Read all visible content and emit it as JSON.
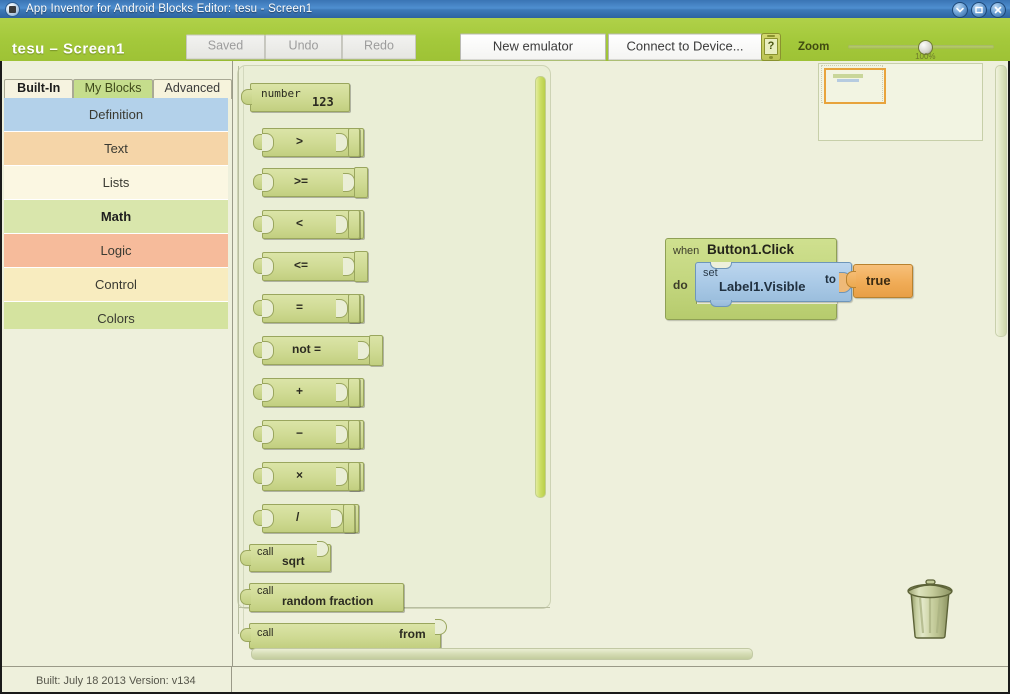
{
  "window": {
    "title": "App Inventor for Android Blocks Editor: tesu - Screen1",
    "app_icon": "app-icon",
    "minimize_icon": "minimize-icon",
    "maximize_icon": "maximize-icon",
    "close_icon": "close-icon"
  },
  "toolbar": {
    "project_title": "tesu – Screen1",
    "saved_label": "Saved",
    "undo_label": "Undo",
    "redo_label": "Redo",
    "new_emulator_label": "New emulator",
    "connect_label": "Connect to Device...",
    "help_icon_label": "?",
    "zoom_label": "Zoom",
    "zoom_value": "100%",
    "accent_green": "#a4c93b"
  },
  "left_panel": {
    "tabs": [
      {
        "label": "Built-In",
        "selected": true
      },
      {
        "label": "My Blocks",
        "selected": false
      },
      {
        "label": "Advanced",
        "selected": false
      }
    ],
    "categories": [
      {
        "label": "Definition",
        "color": "#b3d1ea",
        "selected": false
      },
      {
        "label": "Text",
        "color": "#f5d5a8",
        "selected": false
      },
      {
        "label": "Lists",
        "color": "#fbf7e2",
        "selected": false
      },
      {
        "label": "Math",
        "color": "#d9e6ac",
        "selected": true
      },
      {
        "label": "Logic",
        "color": "#f6bb9b",
        "selected": false
      },
      {
        "label": "Control",
        "color": "#f8ecbf",
        "selected": false
      },
      {
        "label": "Colors",
        "color": "#d4e39f",
        "selected": false
      }
    ]
  },
  "status_bar": {
    "build_info": "Built: July 18 2013 Version: v134"
  },
  "palette": {
    "category": "Math",
    "blocks": [
      {
        "kind": "number",
        "label": "number",
        "value": "123"
      },
      {
        "kind": "operator",
        "label": ">"
      },
      {
        "kind": "operator",
        "label": ">="
      },
      {
        "kind": "operator",
        "label": "<"
      },
      {
        "kind": "operator",
        "label": "<="
      },
      {
        "kind": "operator",
        "label": "="
      },
      {
        "kind": "operator",
        "label": "not ="
      },
      {
        "kind": "operator",
        "label": "+"
      },
      {
        "kind": "operator",
        "label": "−"
      },
      {
        "kind": "operator",
        "label": "×"
      },
      {
        "kind": "operator",
        "label": "/"
      },
      {
        "kind": "call",
        "call_label": "call",
        "label": "sqrt"
      },
      {
        "kind": "call",
        "call_label": "call",
        "label": "random fraction"
      },
      {
        "kind": "call2",
        "call_label": "call",
        "label": "",
        "suffix": "from"
      }
    ]
  },
  "workspace": {
    "program": {
      "event_keyword": "when",
      "event_name": "Button1.Click",
      "do_keyword": "do",
      "set_keyword": "set",
      "set_target": "Label1.Visible",
      "to_keyword": "to",
      "value": "true",
      "event_color": "#c3d67e",
      "set_color": "#a9c9e6",
      "value_color": "#f0ac57"
    },
    "trash_icon": "trash-can-icon",
    "minimap_label": "minimap-viewport"
  }
}
